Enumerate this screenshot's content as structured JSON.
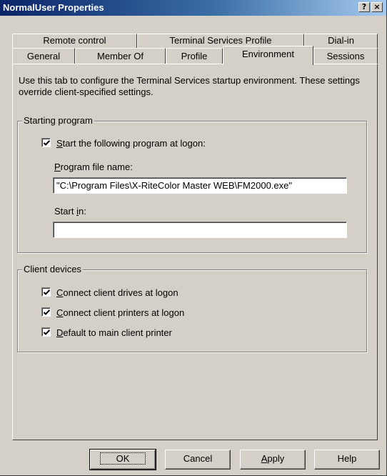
{
  "window": {
    "title": "NormalUser Properties",
    "help_button": "?",
    "close_button": "×"
  },
  "tabs": {
    "row1": [
      {
        "label": "Remote control"
      },
      {
        "label": "Terminal Services Profile"
      },
      {
        "label": "Dial-in"
      }
    ],
    "row2": [
      {
        "label": "General"
      },
      {
        "label": "Member Of"
      },
      {
        "label": "Profile"
      },
      {
        "label": "Environment",
        "active": true
      },
      {
        "label": "Sessions"
      }
    ]
  },
  "environment": {
    "description": "Use this tab to configure the Terminal Services startup environment. These settings override client-specified settings.",
    "starting_program": {
      "group_label": "Starting program",
      "start_checkbox": {
        "label_pre": "",
        "label_key": "S",
        "label_post": "tart the following program at logon:",
        "checked": true
      },
      "program_label": {
        "pre": "",
        "key": "P",
        "post": "rogram file name:"
      },
      "program_value": "\"C:\\Program Files\\X-RiteColor Master WEB\\FM2000.exe\"",
      "start_in_label": {
        "pre": "Start ",
        "key": "i",
        "post": "n:"
      },
      "start_in_value": ""
    },
    "client_devices": {
      "group_label": "Client devices",
      "items": [
        {
          "key": "C",
          "post": "onnect client drives at logon",
          "checked": true
        },
        {
          "key": "C",
          "post": "onnect client printers at logon",
          "checked": true
        },
        {
          "key": "D",
          "post": "efault to main client printer",
          "checked": true
        }
      ]
    }
  },
  "buttons": {
    "ok": "OK",
    "cancel": "Cancel",
    "apply_key": "A",
    "apply_post": "pply",
    "help": "Help"
  }
}
